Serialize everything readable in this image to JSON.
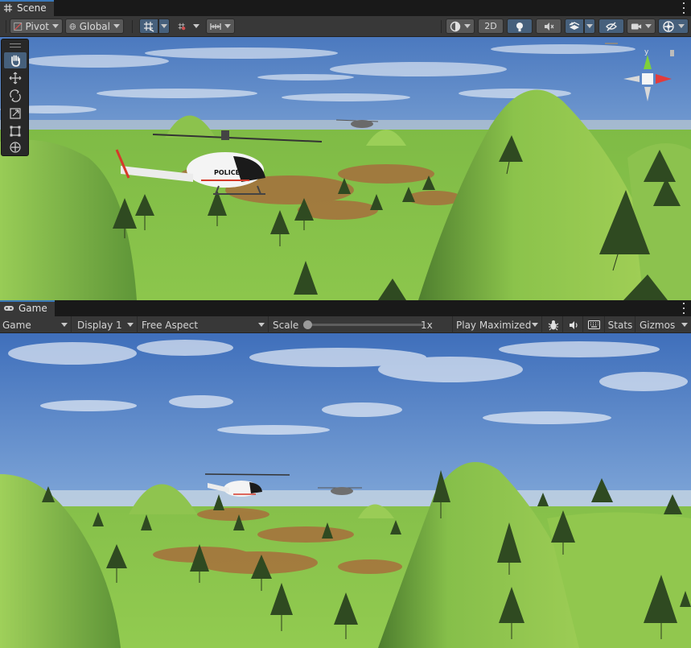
{
  "scene_tab": {
    "label": "Scene",
    "icon": "hashtag-grid-icon"
  },
  "scene_toolbar": {
    "pivot_label": "Pivot",
    "global_label": "Global",
    "mode_2d_label": "2D",
    "icons": [
      "pivot-icon",
      "global-icon",
      "grid-snap-icon",
      "increment-snap-icon",
      "ruler-icon",
      "shading-mode-icon",
      "lighting-icon",
      "audio-mute-icon",
      "effects-icon",
      "hidden-objects-icon",
      "camera-icon",
      "gizmos-icon"
    ]
  },
  "tool_palette": {
    "tools": [
      "hand-tool-icon",
      "move-tool-icon",
      "rotate-tool-icon",
      "scale-tool-icon",
      "rect-tool-icon",
      "transform-tool-icon"
    ],
    "active": "hand-tool-icon"
  },
  "scene_view": {
    "helicopter_decal": "POLICE",
    "orientation_gizmo_axis": "y"
  },
  "game_tab": {
    "label": "Game",
    "icon": "gamepad-icon"
  },
  "game_toolbar": {
    "view_select": "Game",
    "display_select": "Display 1",
    "aspect_select": "Free Aspect",
    "scale_label": "Scale",
    "scale_value_text": "1x",
    "scale_value": 0.0,
    "play_mode_select": "Play Maximized",
    "stats_label": "Stats",
    "gizmos_label": "Gizmos",
    "icons": [
      "bug-icon",
      "speaker-icon",
      "keyboard-icon"
    ]
  },
  "colors": {
    "accent": "#46607c",
    "tab_indicator": "#3a79bb",
    "panel": "#383838",
    "button": "#585858",
    "sky": "#5a86c4",
    "terrain_green": "#86c34a",
    "terrain_dirt": "#a8673c",
    "gizmo_y": "#7fd13a",
    "gizmo_x": "#e23c3c"
  }
}
